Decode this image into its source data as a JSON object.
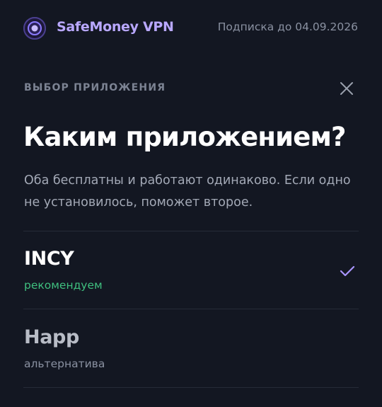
{
  "header": {
    "brand": "SafeMoney VPN",
    "subscription": "Подписка до 04.09.2026",
    "logo_icon": "vpn-logo-icon"
  },
  "dialog": {
    "section_label": "ВЫБОР ПРИЛОЖЕНИЯ",
    "close_icon": "close-icon",
    "title": "Каким приложением?",
    "description": "Оба бесплатны и работают одинаково. Если одно не установилось, поможет второе."
  },
  "options": [
    {
      "name": "INCY",
      "subtitle": "рекомендуем",
      "selected": true,
      "selected_icon": "checkmark-icon"
    },
    {
      "name": "Happ",
      "subtitle": "альтернатива",
      "selected": false
    }
  ],
  "colors": {
    "background": "#131722",
    "brand": "#b9a8ff",
    "accent": "#a995ff",
    "recommended": "#3fbf7f",
    "muted": "#8a91a1",
    "divider": "#262b38"
  }
}
